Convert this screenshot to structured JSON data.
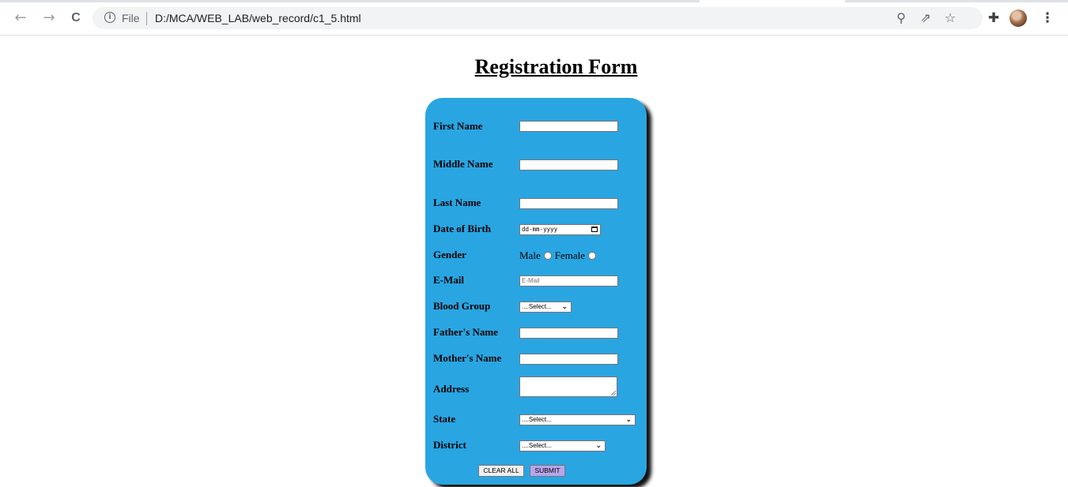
{
  "browser": {
    "scheme_label": "File",
    "url": "D:/MCA/WEB_LAB/web_record/c1_5.html",
    "nav": {
      "back": "←",
      "forward": "→",
      "reload": "C"
    }
  },
  "form": {
    "title": "Registration Form",
    "fields": {
      "first_name_label": "First Name",
      "middle_name_label": "Middle Name",
      "last_name_label": "Last Name",
      "dob_label": "Date of Birth",
      "dob_placeholder": "dd-mm-yyyy",
      "gender_label": "Gender",
      "gender_male": "Male",
      "gender_female": "Female",
      "email_label": "E-Mail",
      "email_placeholder": "E-Mail",
      "blood_group_label": "Blood Group",
      "blood_group_value": "....Select...",
      "father_label": "Father's Name",
      "mother_label": "Mother's Name",
      "address_label": "Address",
      "state_label": "State",
      "state_value": "....Select...",
      "district_label": "District",
      "district_value": "....Select..."
    },
    "buttons": {
      "clear": "CLEAR ALL",
      "submit": "SUBMIT"
    },
    "colors": {
      "card": "#29a5e2",
      "submit_bg": "#b6a6ea",
      "clear_bg": "#efefef"
    }
  }
}
